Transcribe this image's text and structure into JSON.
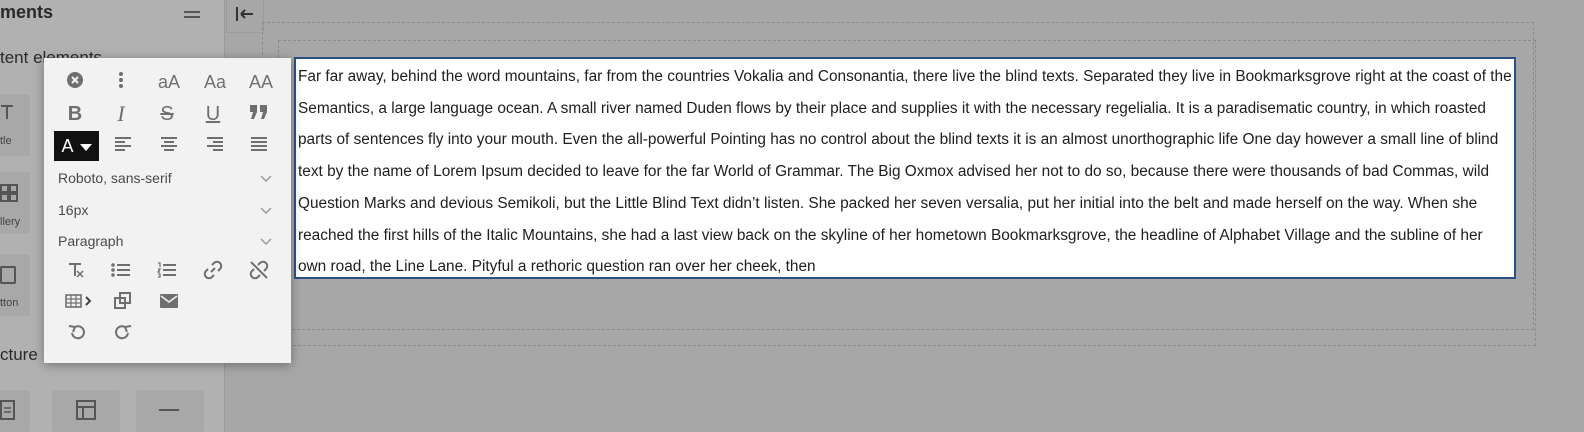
{
  "sidebar": {
    "title": "ments",
    "section_content": "tent elements",
    "section_structure": "cture",
    "tiles": [
      {
        "label": "tle",
        "icon": "text-title-icon"
      },
      {
        "label": "llery",
        "icon": "gallery-icon"
      },
      {
        "label": "tton",
        "icon": "button-icon"
      }
    ]
  },
  "toolbar": {
    "font_family": "Roboto, sans-serif",
    "font_size": "16px",
    "block_type": "Paragraph",
    "text_case_lower": "aA",
    "text_case_title": "Aa",
    "text_case_upper": "AA",
    "color_label": "A"
  },
  "editor": {
    "body_text": "Far far away, behind the word mountains, far from the countries Vokalia and Consonantia, there live the blind texts. Separated they live in Bookmarksgrove right at the coast of the Semantics, a large language ocean. A small river named Duden flows by their place and supplies it with the necessary regelialia. It is a paradisematic country, in which roasted parts of sentences fly into your mouth. Even the all-powerful Pointing has no control about the blind texts it is an almost unorthographic life One day however a small line of blind text by the name of Lorem Ipsum decided to leave for the far World of Grammar. The Big Oxmox advised her not to do so, because there were thousands of bad Commas, wild Question Marks and devious Semikoli, but the Little Blind Text didn’t listen. She packed her seven versalia, put her initial into the belt and made herself on the way. When she reached the first hills of the Italic Mountains, she had a last view back on the skyline of her hometown Bookmarksgrove, the headline of Alphabet Village and the subline of her own road, the Line Lane. Pityful a rethoric question ran over her cheek, then"
  }
}
